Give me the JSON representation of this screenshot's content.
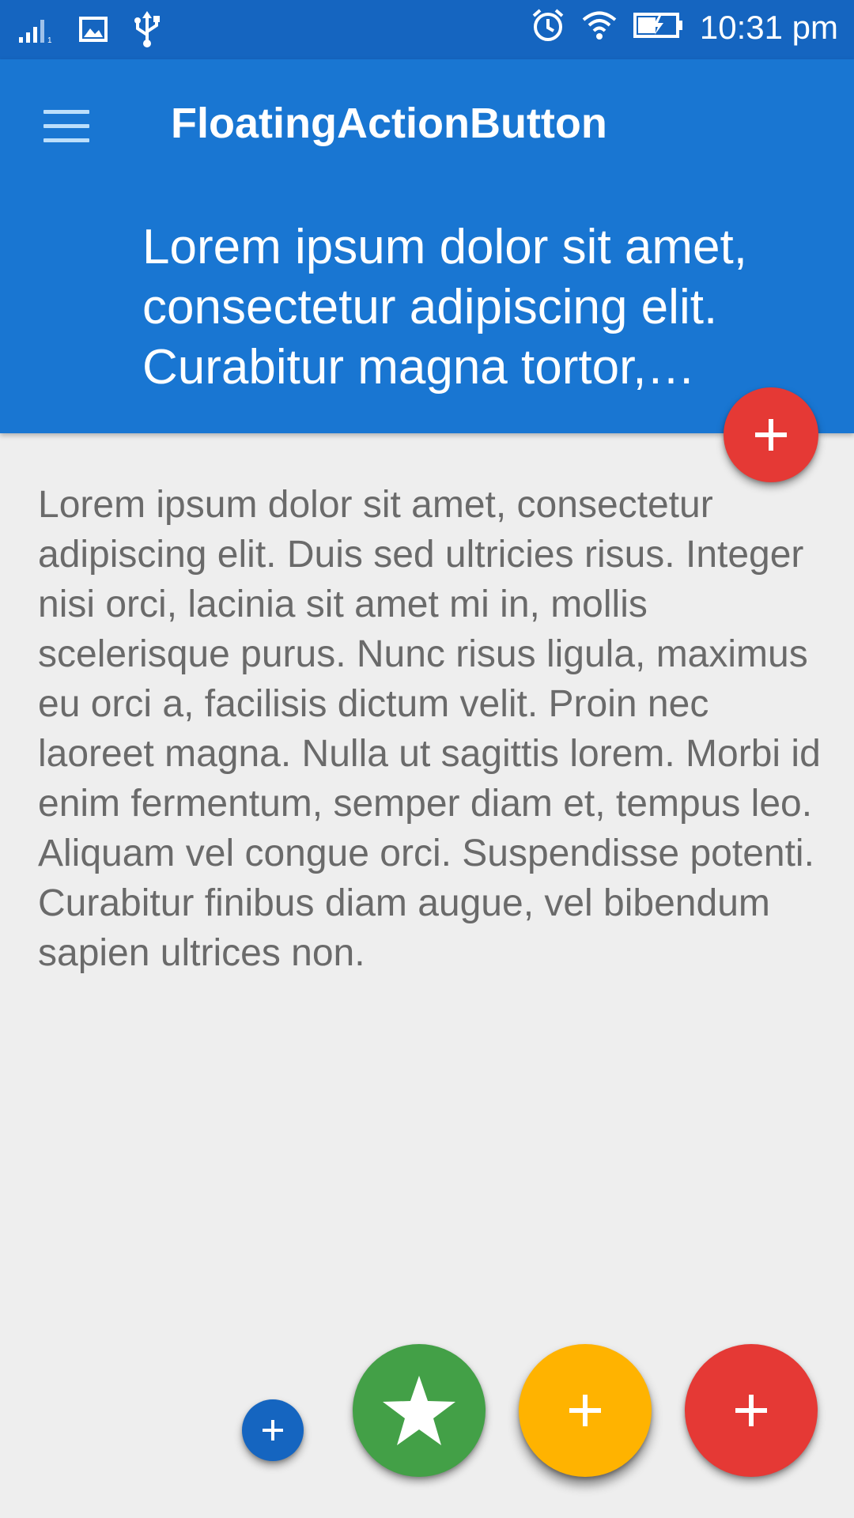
{
  "status_bar": {
    "time": "10:31 pm",
    "left_icons": [
      "signal-icon",
      "image-icon",
      "usb-icon"
    ],
    "right_icons": [
      "alarm-icon",
      "wifi-icon",
      "battery-charging-icon"
    ]
  },
  "toolbar": {
    "title": "FloatingActionButton",
    "subtitle": "Lorem ipsum dolor sit amet, consectetur adipiscing elit. Curabitur magna tortor, pellentesque ut dapibus a, molestie sit amet tortor.",
    "menu_icon": "hamburger-menu-icon"
  },
  "content": {
    "body": "Lorem ipsum dolor sit amet, consectetur adipiscing elit. Duis sed ultricies risus. Integer nisi orci, lacinia sit amet mi in, mollis scelerisque purus. Nunc risus ligula, maximus eu orci a, facilisis dictum velit. Proin nec laoreet magna. Nulla ut sagittis lorem. Morbi id enim fermentum, semper diam et, tempus leo. Aliquam vel congue orci. Suspendisse potenti. Curabitur finibus diam augue, vel bibendum sapien ultrices non."
  },
  "fabs": [
    {
      "name": "toolbar-add-fab",
      "icon": "plus-icon",
      "color": "#e53935"
    },
    {
      "name": "mini-add-fab",
      "icon": "plus-icon",
      "color": "#1565c0"
    },
    {
      "name": "star-fab",
      "icon": "star-icon",
      "color": "#43a047"
    },
    {
      "name": "yellow-add-fab",
      "icon": "plus-icon",
      "color": "#ffb300"
    },
    {
      "name": "red-add-fab",
      "icon": "plus-icon",
      "color": "#e53935"
    }
  ],
  "colors": {
    "status_bar": "#1565c0",
    "toolbar": "#1976d2",
    "background": "#eeeeee",
    "body_text": "#6a6a6a"
  }
}
